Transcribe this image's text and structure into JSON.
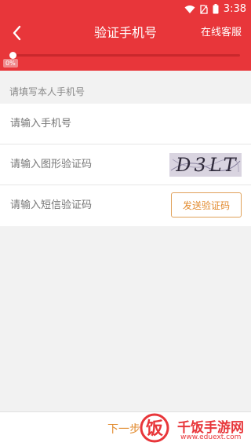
{
  "status": {
    "time": "3:38"
  },
  "header": {
    "title": "验证手机号",
    "service_label": "在线客服"
  },
  "progress": {
    "label": "0%",
    "value": 0
  },
  "form": {
    "section_label": "请填写本人手机号",
    "phone_placeholder": "请输入手机号",
    "captcha_placeholder": "请输入图形验证码",
    "captcha_text": "D3LT",
    "sms_placeholder": "请输入短信验证码",
    "send_code_label": "发送验证码"
  },
  "footer": {
    "next_label": "下一步"
  },
  "watermark": {
    "logo_char": "饭",
    "title": "千饭手游网",
    "url": "www.eduext.com"
  },
  "colors": {
    "brand": "#e8363a",
    "accent": "#e28a2c"
  }
}
